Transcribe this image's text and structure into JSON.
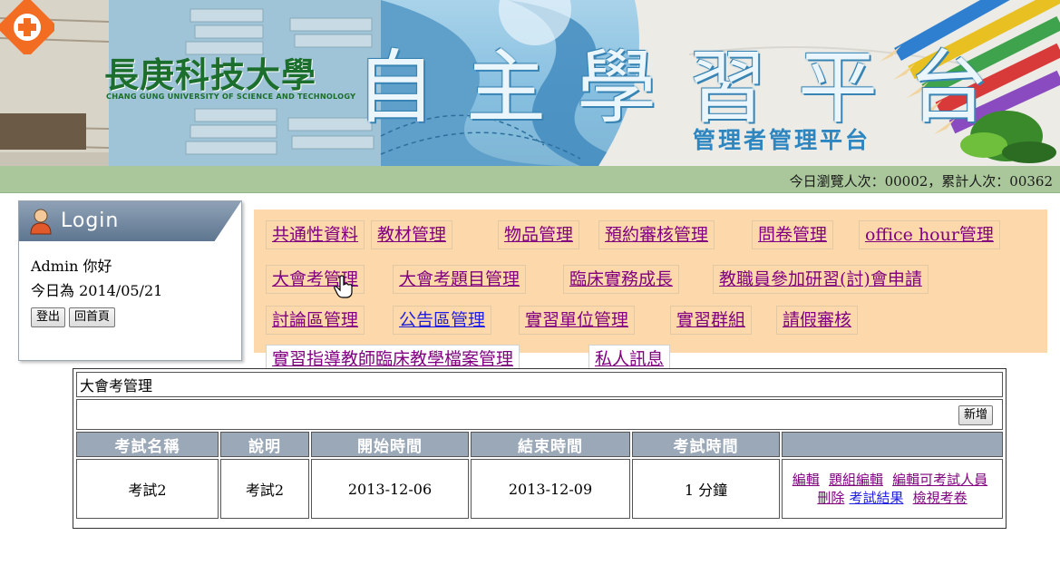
{
  "header": {
    "university_name": "長庚科技大學",
    "university_name_en": "CHANG GUNG UNIVERSITY OF SCIENCE AND TECHNOLOGY",
    "platform_title": "自主學習平台",
    "platform_subtitle": "管理者管理平台",
    "counter": "今日瀏覽人次：00002，累計人次：00362"
  },
  "login": {
    "title": "Login",
    "greeting": "Admin 你好",
    "today": "今日為 2014/05/21",
    "logout_label": "登出",
    "home_label": "回首頁"
  },
  "menu": {
    "items": [
      "共通性資料",
      "教材管理",
      "物品管理",
      "預約審核管理",
      "問卷管理",
      "office hour管理",
      "大會考管理",
      "大會考題目管理",
      "臨床實務成長",
      "教職員參加研習(討)會申請",
      "討論區管理",
      "公告區管理",
      "實習單位管理",
      "實習群組",
      "請假審核",
      "實習指導教師臨床教學檔案管理",
      "私人訊息"
    ]
  },
  "exam_table": {
    "caption": "大會考管理",
    "add_label": "新增",
    "columns": [
      "考試名稱",
      "說明",
      "開始時間",
      "結束時間",
      "考試時間",
      ""
    ],
    "rows": [
      {
        "name": "考試2",
        "description": "考試2",
        "start": "2013-12-06",
        "end": "2013-12-09",
        "duration": "1 分鐘",
        "actions": [
          "編輯",
          "題組編輯",
          "編輯可考試人員",
          "刪除",
          "考試結果",
          "檢視考卷"
        ]
      }
    ]
  },
  "colors": {
    "menu_bg": "#fdd8aa",
    "counter_bg": "#a9c79b",
    "table_header_bg": "#9ba8b8",
    "link_visited": "#800080",
    "link_unvisited": "#1f1ee0"
  }
}
